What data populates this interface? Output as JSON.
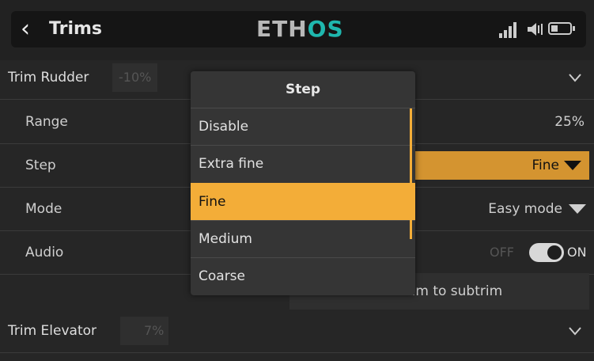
{
  "header": {
    "title": "Trims",
    "logo_part1": "ETH",
    "logo_part2": "OS",
    "icons": [
      "back-icon",
      "signal-icon",
      "speaker-icon",
      "battery-icon"
    ],
    "colors": {
      "accent": "#f3ad38",
      "logo_accent": "#1fb7ae"
    }
  },
  "trim_rudder": {
    "label": "Trim Rudder",
    "value": "-10%"
  },
  "rows": {
    "range": {
      "label": "Range",
      "value": "25%"
    },
    "step": {
      "label": "Step",
      "value": "Fine"
    },
    "mode": {
      "label": "Mode",
      "value": "Easy mode"
    },
    "audio": {
      "label": "Audio",
      "off": "OFF",
      "on": "ON"
    }
  },
  "move_button": {
    "label": "Move trim to subtrim"
  },
  "trim_elevator": {
    "label": "Trim Elevator",
    "value": "7%"
  },
  "popup": {
    "title": "Step",
    "options": [
      "Disable",
      "Extra fine",
      "Fine",
      "Medium",
      "Coarse"
    ],
    "selected": "Fine"
  }
}
